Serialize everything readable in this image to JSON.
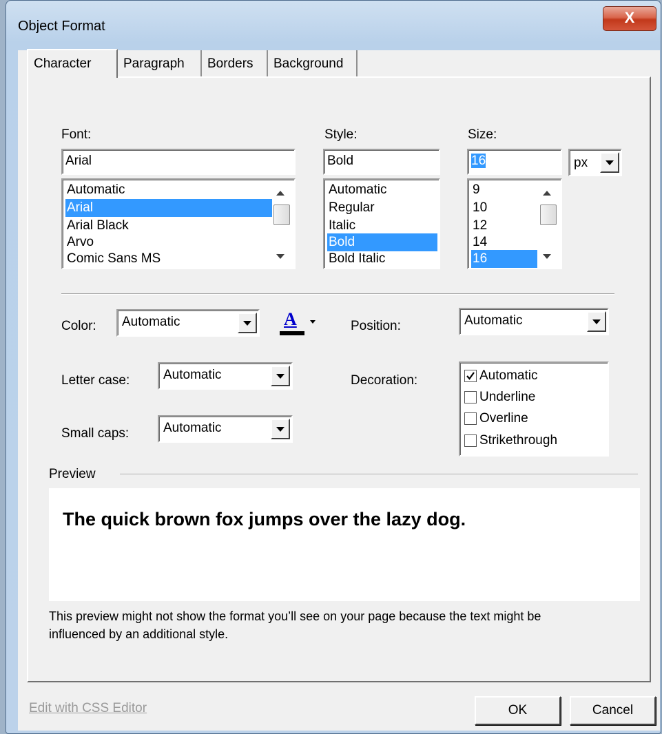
{
  "window": {
    "title": "Object Format",
    "close_glyph": "X"
  },
  "tabs": [
    "Character",
    "Paragraph",
    "Borders",
    "Background"
  ],
  "font": {
    "label": "Font:",
    "value": "Arial",
    "options": [
      "Automatic",
      "Arial",
      "Arial Black",
      "Arvo",
      "Comic Sans MS"
    ],
    "selected_index": 1
  },
  "style": {
    "label": "Style:",
    "value": "Bold",
    "options": [
      "Automatic",
      "Regular",
      "Italic",
      "Bold",
      "Bold Italic"
    ],
    "selected_index": 3
  },
  "size": {
    "label": "Size:",
    "value": "16",
    "unit": "px",
    "options": [
      "9",
      "10",
      "12",
      "14",
      "16"
    ],
    "selected_index": 4
  },
  "color": {
    "label": "Color:",
    "value": "Automatic",
    "picker_glyph": "A",
    "picker_icon": "font-color-icon",
    "swatch": "#000000",
    "glyph_color": "#0000cc"
  },
  "position": {
    "label": "Position:",
    "value": "Automatic"
  },
  "letter_case": {
    "label": "Letter case:",
    "value": "Automatic"
  },
  "small_caps": {
    "label": "Small caps:",
    "value": "Automatic"
  },
  "decoration": {
    "label": "Decoration:",
    "options": [
      {
        "label": "Automatic",
        "checked": true
      },
      {
        "label": "Underline",
        "checked": false
      },
      {
        "label": "Overline",
        "checked": false
      },
      {
        "label": "Strikethrough",
        "checked": false
      }
    ]
  },
  "preview": {
    "label": "Preview",
    "sample_text": "The quick brown fox jumps over the lazy dog.",
    "note_line1": "This preview might not show the format you’ll see on your page because the text might be",
    "note_line2": "influenced by an additional style."
  },
  "footer": {
    "css_link": "Edit with CSS Editor",
    "ok": "OK",
    "cancel": "Cancel"
  },
  "colors": {
    "selection": "#3399ff",
    "dialog_bg": "#f0f0f0",
    "close_button": "#c2391b"
  }
}
